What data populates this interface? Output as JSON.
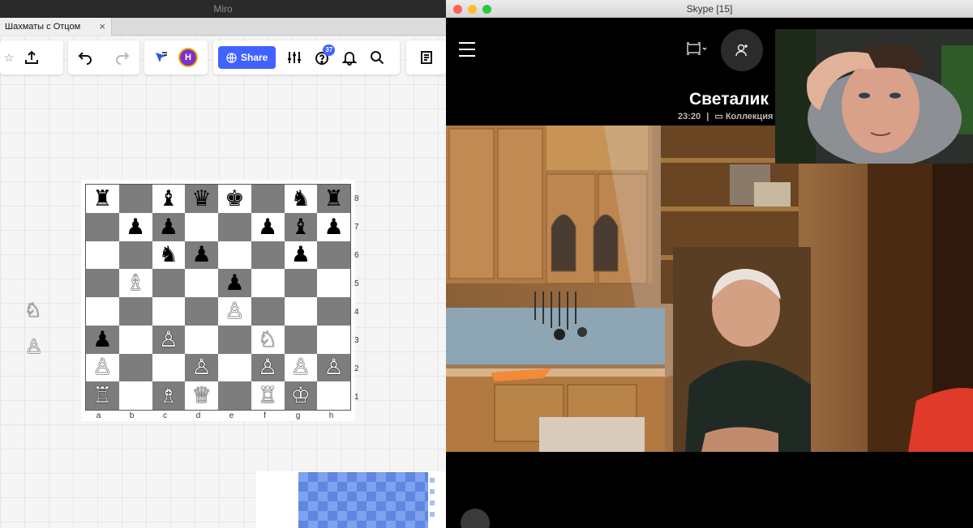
{
  "miro": {
    "window_title": "Miro",
    "tab_title": "Шахматы с Отцом",
    "tab_close": "×",
    "share_label": "Share",
    "avatar_initial": "H",
    "help_badge": "37",
    "icons": [
      "star-icon",
      "export-icon",
      "undo-icon",
      "redo-icon",
      "cursor-icon",
      "globe-icon",
      "settings-sliders-icon",
      "help-icon",
      "bell-icon",
      "search-icon",
      "notes-icon"
    ],
    "accent_color": "#4262ff"
  },
  "chess": {
    "files": [
      "a",
      "b",
      "c",
      "d",
      "e",
      "f",
      "g",
      "h"
    ],
    "ranks": [
      "8",
      "7",
      "6",
      "5",
      "4",
      "3",
      "2",
      "1"
    ],
    "board": [
      [
        "b:♜",
        "",
        "b:♝",
        "b:♛",
        "b:♚",
        "",
        "b:♞",
        "b:♜"
      ],
      [
        "",
        "b:♟",
        "b:♟",
        "",
        "",
        "b:♟",
        "b:♝",
        "b:♟"
      ],
      [
        "",
        "",
        "b:♞",
        "b:♟",
        "",
        "",
        "b:♟",
        ""
      ],
      [
        "",
        "w:♗",
        "",
        "",
        "b:♟",
        "",
        "",
        ""
      ],
      [
        "",
        "",
        "",
        "",
        "w:♙",
        "",
        "",
        ""
      ],
      [
        "b:♟",
        "",
        "w:♙",
        "",
        "",
        "w:♘",
        "",
        ""
      ],
      [
        "w:♙",
        "",
        "",
        "w:♙",
        "",
        "w:♙",
        "w:♙",
        "w:♙"
      ],
      [
        "w:♖",
        "",
        "w:♗",
        "w:♕",
        "",
        "w:♖",
        "w:♔",
        ""
      ]
    ],
    "side_pieces": [
      {
        "color": "w",
        "glyph": "♘"
      },
      {
        "color": "w",
        "glyph": "♙"
      }
    ]
  },
  "skype": {
    "window_title": "Skype [15]",
    "caller_name": "Светалик",
    "call_time": "23:20",
    "separator": "|",
    "collection_label": "Коллекция",
    "icons": [
      "menu-icon",
      "screen-layout-icon",
      "add-person-icon",
      "skype-logo-icon"
    ]
  }
}
